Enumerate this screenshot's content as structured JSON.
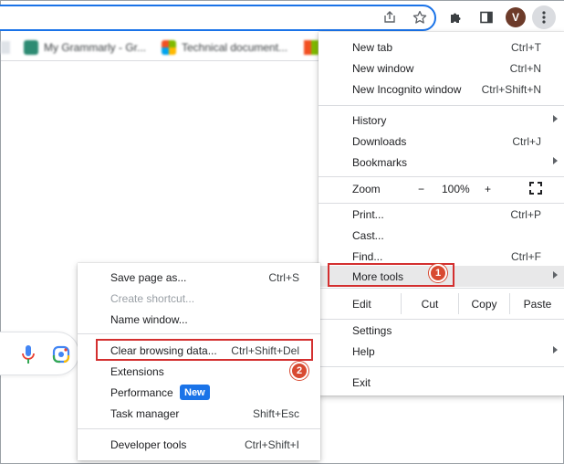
{
  "main_menu": {
    "items": {
      "new_tab": {
        "label": "New tab",
        "shortcut": "Ctrl+T"
      },
      "new_window": {
        "label": "New window",
        "shortcut": "Ctrl+N"
      },
      "new_incognito": {
        "label": "New Incognito window",
        "shortcut": "Ctrl+Shift+N"
      },
      "history": {
        "label": "History"
      },
      "downloads": {
        "label": "Downloads",
        "shortcut": "Ctrl+J"
      },
      "bookmarks": {
        "label": "Bookmarks"
      },
      "print": {
        "label": "Print...",
        "shortcut": "Ctrl+P"
      },
      "cast": {
        "label": "Cast..."
      },
      "find": {
        "label": "Find...",
        "shortcut": "Ctrl+F"
      },
      "more_tools": {
        "label": "More tools"
      },
      "settings": {
        "label": "Settings"
      },
      "help": {
        "label": "Help"
      },
      "exit": {
        "label": "Exit"
      }
    },
    "zoom": {
      "label": "Zoom",
      "minus": "−",
      "value": "100%",
      "plus": "+"
    },
    "edit": {
      "label": "Edit",
      "cut": "Cut",
      "copy": "Copy",
      "paste": "Paste"
    }
  },
  "sub_menu": {
    "items": {
      "save_page": {
        "label": "Save page as...",
        "shortcut": "Ctrl+S"
      },
      "create_shortcut": {
        "label": "Create shortcut..."
      },
      "name_window": {
        "label": "Name window..."
      },
      "clear_browsing": {
        "label": "Clear browsing data...",
        "shortcut": "Ctrl+Shift+Del"
      },
      "extensions": {
        "label": "Extensions"
      },
      "performance": {
        "label": "Performance",
        "badge": "New"
      },
      "task_manager": {
        "label": "Task manager",
        "shortcut": "Shift+Esc"
      },
      "developer_tools": {
        "label": "Developer tools",
        "shortcut": "Ctrl+Shift+I"
      }
    }
  },
  "bookmarks_bar": [
    {
      "label": "My Grammarly - Gr..."
    },
    {
      "label": "Technical document..."
    }
  ],
  "profile": {
    "initial": "V"
  },
  "annotations": {
    "step1": "1",
    "step2": "2"
  },
  "colors": {
    "accent": "#1a73e8",
    "annotation_red": "#d32f2f",
    "step_marker": "#d84a31"
  }
}
